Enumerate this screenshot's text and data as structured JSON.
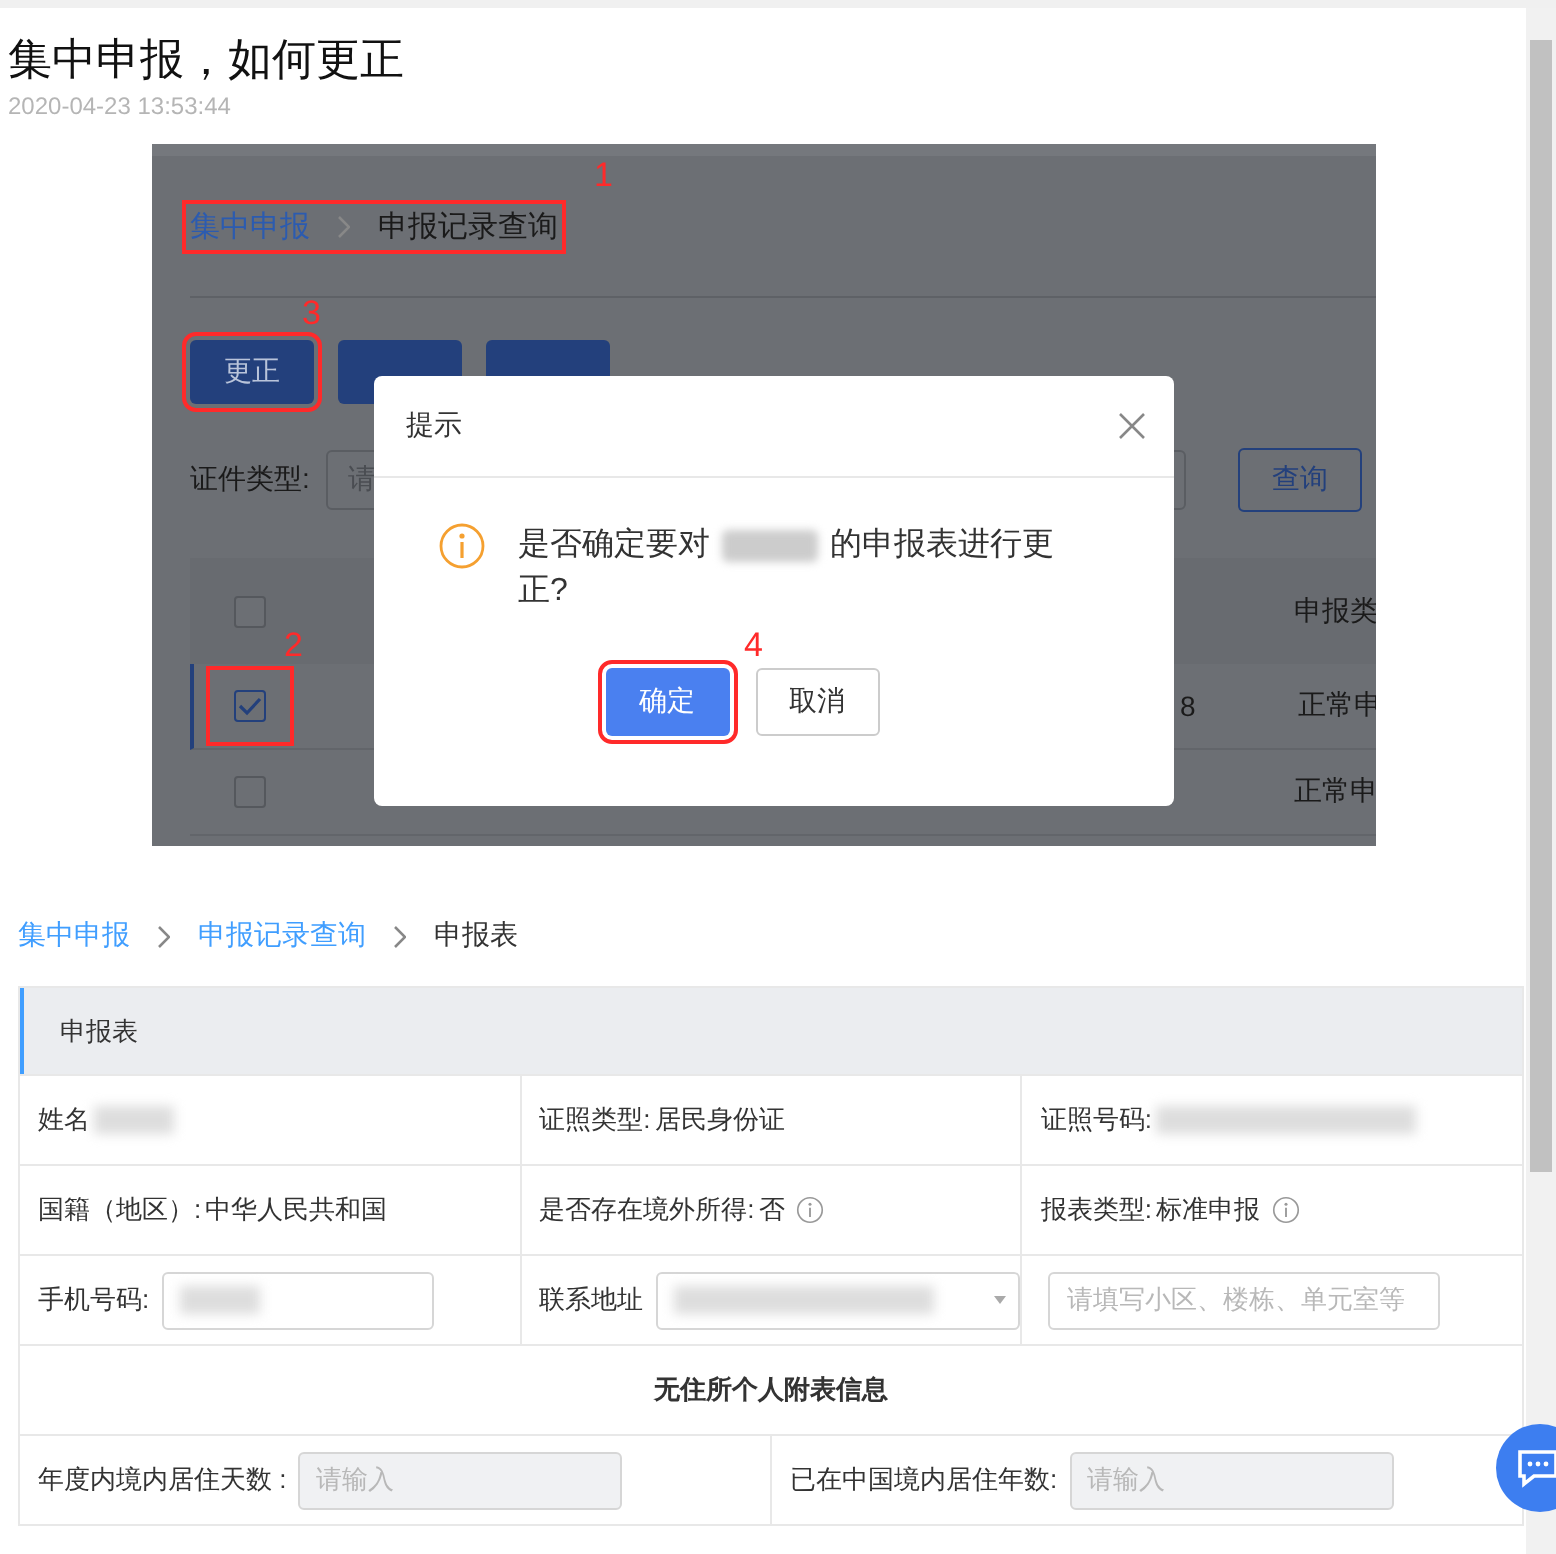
{
  "article": {
    "title": "集中申报，如何更正",
    "date": "2020-04-23 13:53:44"
  },
  "screenshot": {
    "breadcrumb": {
      "items": [
        {
          "label": "集中申报",
          "link": true
        },
        {
          "label": "申报记录查询",
          "link": false
        }
      ],
      "mark": "1"
    },
    "buttons": [
      {
        "kind": "labelled",
        "label": "更正",
        "mark": "3"
      },
      {
        "kind": "covered"
      },
      {
        "kind": "covered"
      }
    ],
    "filter": {
      "label": "证件类型:",
      "placeholder": "请"
    },
    "query_button": "查询",
    "table": {
      "header_checked": false,
      "column_header": "申报类",
      "rows": [
        {
          "checked": true,
          "selected": true,
          "id_tail": "8",
          "type": "正常申",
          "mark": "2"
        },
        {
          "checked": false,
          "selected": false,
          "type": "正常申"
        }
      ]
    },
    "dialog": {
      "title": "提示",
      "message_before": "是否确定要对",
      "redacted": true,
      "message_after": "的申报表进行更正?",
      "buttons": [
        {
          "label": "确定",
          "primary": true,
          "mark": "4"
        },
        {
          "label": "取消",
          "primary": false
        }
      ]
    }
  },
  "breadcrumb": [
    {
      "label": "集中申报",
      "link": true
    },
    {
      "label": "申报记录查询",
      "link": true
    },
    {
      "label": "申报表",
      "link": false
    }
  ],
  "form": {
    "title": "申报表",
    "rows": [
      {
        "kind": "cells",
        "cells": [
          {
            "label": "姓名",
            "redacted": true,
            "info": false
          },
          {
            "label": "证照类型:",
            "value": "居民身份证",
            "redacted": false,
            "info": false
          },
          {
            "label": "证照号码:",
            "redacted": true,
            "info": false
          }
        ]
      },
      {
        "kind": "cells",
        "cells": [
          {
            "label": "国籍（地区）:",
            "value": "中华人民共和国",
            "redacted": false,
            "info": false
          },
          {
            "label": "是否存在境外所得:",
            "value": "否",
            "redacted": false,
            "info": true
          },
          {
            "label": "报表类型:",
            "value": "标准申报",
            "redacted": false,
            "info": true
          }
        ]
      },
      {
        "kind": "inputs",
        "cells": [
          {
            "label": "手机号码:",
            "redacted": true,
            "dropdown": false,
            "disabled": false
          },
          {
            "label": "联系地址",
            "redacted": true,
            "dropdown": true,
            "disabled": false
          },
          {
            "placeholder": "请填写小区、楼栋、单元室等",
            "redacted": false,
            "dropdown": false,
            "disabled": false
          }
        ]
      },
      {
        "kind": "heading",
        "text": "无住所个人附表信息"
      },
      {
        "kind": "inputs",
        "cells": [
          {
            "label": "年度内境内居住天数 :",
            "placeholder": "请输入",
            "redacted": false,
            "dropdown": false,
            "disabled": true
          },
          {
            "label": "已在中国境内居住年数:",
            "placeholder": "请输入",
            "redacted": false,
            "dropdown": false,
            "disabled": true
          }
        ]
      }
    ]
  }
}
